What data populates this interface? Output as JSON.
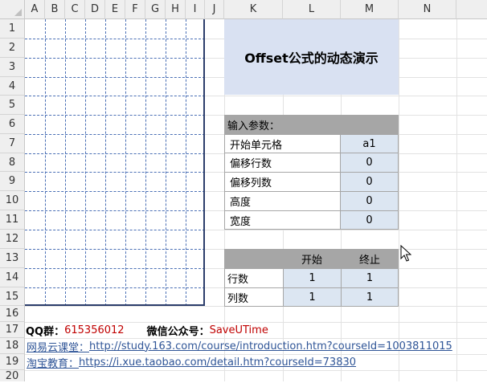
{
  "columns": [
    "A",
    "B",
    "C",
    "D",
    "E",
    "F",
    "G",
    "H",
    "I",
    "J",
    "K",
    "L",
    "M",
    "N"
  ],
  "rows": [
    "1",
    "2",
    "3",
    "4",
    "5",
    "6",
    "7",
    "8",
    "9",
    "10",
    "11",
    "12",
    "13",
    "14",
    "15",
    "16",
    "17",
    "18",
    "19",
    "20"
  ],
  "title": "Offset公式的动态演示",
  "params": {
    "header": "输入参数：",
    "items": [
      {
        "label": "开始单元格",
        "value": "a1"
      },
      {
        "label": "偏移行数",
        "value": "0"
      },
      {
        "label": "偏移列数",
        "value": "0"
      },
      {
        "label": "高度",
        "value": "0"
      },
      {
        "label": "宽度",
        "value": "0"
      }
    ]
  },
  "result": {
    "col_start": "开始",
    "col_end": "终止",
    "rows": [
      {
        "label": "行数",
        "start": "1",
        "end": "1"
      },
      {
        "label": "列数",
        "start": "1",
        "end": "1"
      }
    ]
  },
  "info": {
    "qq_label": "QQ群：",
    "qq_value": "615356012",
    "wechat_label": "微信公众号：",
    "wechat_value": "SaveUTime",
    "netease_label": "网易云课堂：",
    "netease_url": "http://study.163.com/course/introduction.htm?courseId=1003811015",
    "taobao_label": "淘宝教育：",
    "taobao_url": "https://i.xue.taobao.com/detail.htm?courseId=73830"
  },
  "colors": {
    "title_fill": "#d9e1f2",
    "value_fill": "#dce6f2",
    "header_fill": "#a6a6a6",
    "red_text": "#c00000",
    "link_text": "#2f5597"
  }
}
